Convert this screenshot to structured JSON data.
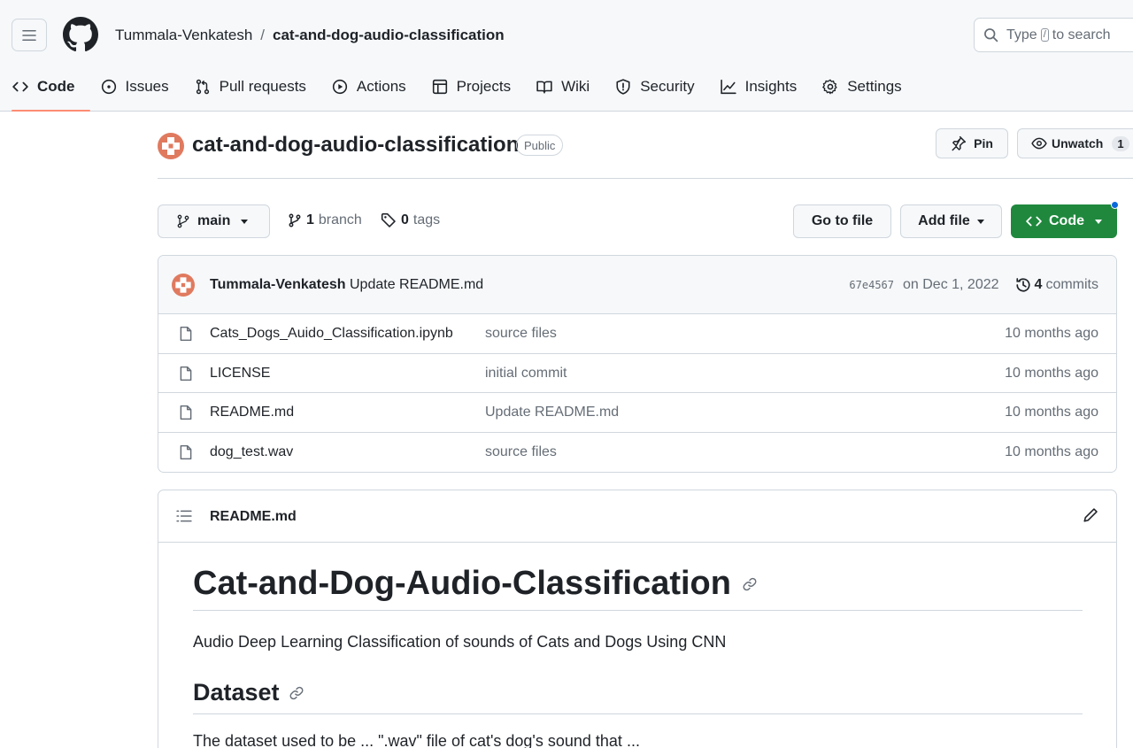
{
  "header": {
    "owner": "Tummala-Venkatesh",
    "separator": "/",
    "repo": "cat-and-dog-audio-classification",
    "search": {
      "prefix": "Type",
      "key": "/",
      "suffix": "to search"
    }
  },
  "nav": {
    "tabs": [
      {
        "label": "Code",
        "icon": "code-icon",
        "active": true
      },
      {
        "label": "Issues",
        "icon": "issue-icon"
      },
      {
        "label": "Pull requests",
        "icon": "pull-request-icon"
      },
      {
        "label": "Actions",
        "icon": "play-icon"
      },
      {
        "label": "Projects",
        "icon": "table-icon"
      },
      {
        "label": "Wiki",
        "icon": "book-icon"
      },
      {
        "label": "Security",
        "icon": "shield-icon"
      },
      {
        "label": "Insights",
        "icon": "graph-icon"
      },
      {
        "label": "Settings",
        "icon": "gear-icon"
      }
    ]
  },
  "repo": {
    "title": "cat-and-dog-audio-classification",
    "visibility": "Public",
    "pin_label": "Pin",
    "watch_label": "Unwatch",
    "watch_count": "1"
  },
  "branchbar": {
    "branch": "main",
    "branch_count": "1",
    "branch_label": "branch",
    "tag_count": "0",
    "tag_label": "tags",
    "goto_label": "Go to file",
    "addfile_label": "Add file",
    "code_label": "Code"
  },
  "commit": {
    "author": "Tummala-Venkatesh",
    "message": "Update README.md",
    "sha": "67e4567",
    "date": "on Dec 1, 2022",
    "count": "4",
    "count_label": "commits"
  },
  "files": [
    {
      "name": "Cats_Dogs_Auido_Classification.ipynb",
      "commit": "source files",
      "age": "10 months ago"
    },
    {
      "name": "LICENSE",
      "commit": "initial commit",
      "age": "10 months ago"
    },
    {
      "name": "README.md",
      "commit": "Update README.md",
      "age": "10 months ago"
    },
    {
      "name": "dog_test.wav",
      "commit": "source files",
      "age": "10 months ago"
    }
  ],
  "readme": {
    "filename": "README.md",
    "h1": "Cat-and-Dog-Audio-Classification",
    "intro": "Audio Deep Learning Classification of sounds of Cats and Dogs Using CNN",
    "h2": "Dataset",
    "cut_line": "The dataset used to be ... \".wav\" file of cat's dog's sound that ..."
  },
  "colors": {
    "accent_underline": "#fd8c73",
    "code_button": "#1f883d",
    "notification_dot": "#0969da",
    "avatar": "#e07a5f"
  }
}
